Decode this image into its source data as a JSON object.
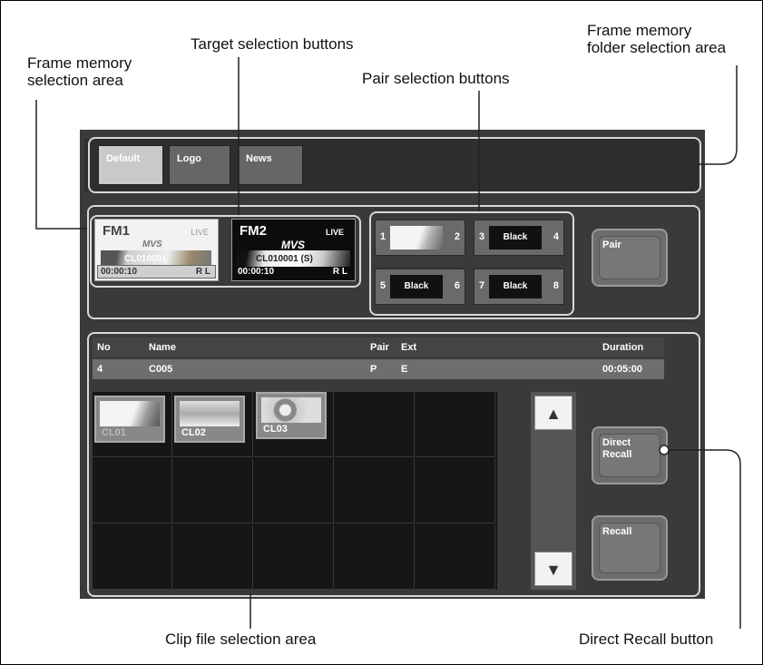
{
  "callouts": {
    "frame_memory_selection_area": "Frame memory\nselection area",
    "target_selection_buttons": "Target selection buttons",
    "pair_selection_buttons": "Pair selection buttons",
    "frame_memory_folder_selection_area": "Frame memory\nfolder selection area",
    "clip_file_selection_area": "Clip file selection area",
    "direct_recall_button": "Direct Recall button"
  },
  "folders": [
    {
      "label": "Default",
      "selected": true
    },
    {
      "label": "Logo",
      "selected": false
    },
    {
      "label": "News",
      "selected": false
    }
  ],
  "fm1": {
    "name": "FM1",
    "live": "LIVE",
    "logo": "MVS",
    "clip": "CL010001",
    "time": "00:00:10",
    "rl": "R L"
  },
  "fm2": {
    "name": "FM2",
    "live": "LIVE",
    "logo": "MVS",
    "clip": "CL010001 (S)",
    "time": "00:00:10",
    "rl": "R L"
  },
  "pairs": [
    {
      "left": "1",
      "right": "2",
      "content": "",
      "thumbnail": true
    },
    {
      "left": "3",
      "right": "4",
      "content": "Black",
      "thumbnail": false
    },
    {
      "left": "5",
      "right": "6",
      "content": "Black",
      "thumbnail": false
    },
    {
      "left": "7",
      "right": "8",
      "content": "Black",
      "thumbnail": false
    }
  ],
  "pair_button": "Pair",
  "table": {
    "headers": {
      "no": "No",
      "name": "Name",
      "pair": "Pair",
      "ext": "Ext",
      "duration": "Duration"
    },
    "row": {
      "no": "4",
      "name": "C005",
      "pair": "P",
      "ext": "E",
      "duration": "00:05:00"
    }
  },
  "clips": [
    "CL01",
    "CL02",
    "CL03"
  ],
  "scroll_up_icon": "triangle-up-icon",
  "scroll_down_icon": "triangle-down-icon",
  "direct_recall_button": "Direct\nRecall",
  "recall_button": "Recall",
  "colors": {
    "panel": "#3a3a3a",
    "button": "#6c6c6c",
    "outline": "#d8d8d8"
  }
}
